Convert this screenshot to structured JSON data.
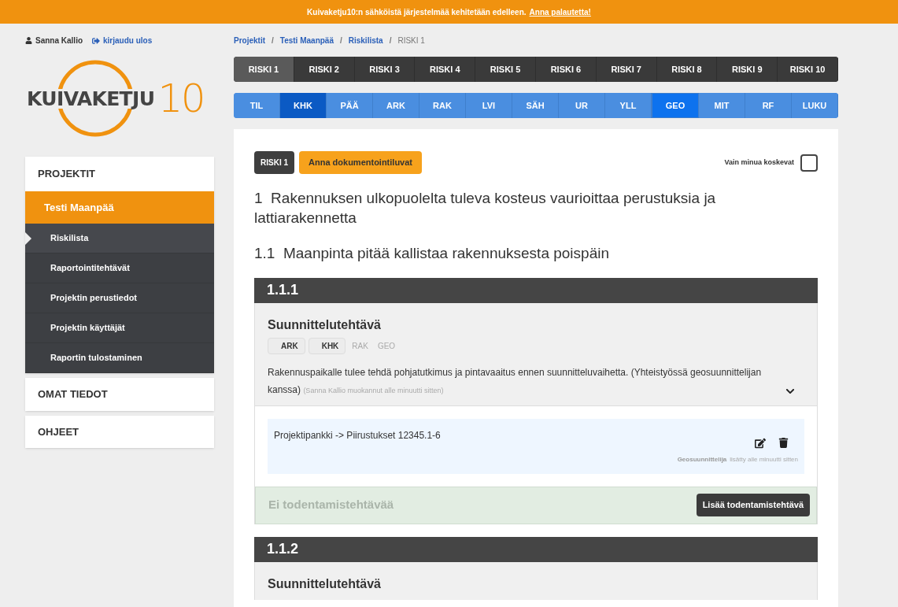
{
  "banner": {
    "text": "Kuivaketju10:n sähköistä järjestelmää kehitetään edelleen.",
    "link": "Anna palautetta!"
  },
  "user": {
    "name": "Sanna Kallio",
    "logout": "kirjaudu ulos"
  },
  "logo": {
    "text": "KUIVAKETJU",
    "number": "10"
  },
  "breadcrumb": [
    {
      "label": "Projektit",
      "link": true
    },
    {
      "separator": "/",
      "label": "Testi Maanpää",
      "link": true
    },
    {
      "separator": "/",
      "label": "Riskilista",
      "link": true
    },
    {
      "separator": "/",
      "label": "RISKI 1",
      "link": false
    }
  ],
  "risk_tabs": [
    {
      "label": "RISKI 1",
      "selected": true
    },
    {
      "label": "RISKI 2",
      "selected": false
    },
    {
      "label": "RISKI 3",
      "selected": false
    },
    {
      "label": "RISKI 4",
      "selected": false
    },
    {
      "label": "RISKI 5",
      "selected": false
    },
    {
      "label": "RISKI 6",
      "selected": false
    },
    {
      "label": "RISKI 7",
      "selected": false
    },
    {
      "label": "RISKI 8",
      "selected": false
    },
    {
      "label": "RISKI 9",
      "selected": false
    },
    {
      "label": "RISKI 10",
      "selected": false
    }
  ],
  "discipline_tabs": [
    {
      "label": "TIL",
      "selected": false,
      "own": false
    },
    {
      "label": "KHK",
      "selected": false,
      "own": true
    },
    {
      "label": "PÄÄ",
      "selected": false,
      "own": false
    },
    {
      "label": "ARK",
      "selected": false,
      "own": false
    },
    {
      "label": "RAK",
      "selected": false,
      "own": false
    },
    {
      "label": "LVI",
      "selected": false,
      "own": false
    },
    {
      "label": "SÄH",
      "selected": false,
      "own": false
    },
    {
      "label": "UR",
      "selected": false,
      "own": false
    },
    {
      "label": "YLL",
      "selected": false,
      "own": false
    },
    {
      "label": "GEO",
      "selected": true,
      "own": false
    },
    {
      "label": "MIT",
      "selected": false,
      "own": false
    },
    {
      "label": "RF",
      "selected": false,
      "own": false
    },
    {
      "label": "LUKU",
      "selected": false,
      "own": false
    }
  ],
  "sidebar": [
    {
      "label": "PROJEKTIT",
      "expanded": true,
      "children": [
        {
          "label": "Testi Maanpää",
          "selected": true,
          "children": [
            {
              "label": "Riskilista",
              "selected": true
            },
            {
              "label": "Raportointitehtävät",
              "selected": false
            },
            {
              "label": "Projektin perustiedot",
              "selected": false
            },
            {
              "label": "Projektin käyttäjät",
              "selected": false
            },
            {
              "label": "Raportin tulostaminen",
              "selected": false
            }
          ]
        }
      ]
    },
    {
      "label": "OMAT TIEDOT",
      "expanded": false
    },
    {
      "label": "OHJEET",
      "expanded": false
    }
  ],
  "content": {
    "risk_badge": "RISKI 1",
    "permissions_button": "Anna dokumentointiluvat",
    "filter": {
      "label": "Vain minua koskevat",
      "checked": false
    },
    "heading": "1  Rakennuksen ulkopuolelta tuleva kosteus vaurioittaa perustuksia ja lattiarakennetta",
    "subheading": "1.1  Maanpinta pitää kallistaa rakennuksesta poispäin",
    "sections": [
      {
        "number": "1.1.1",
        "task_title": "Suunnittelutehtävä",
        "tags": [
          {
            "label": "ARK",
            "active": true
          },
          {
            "label": "KHK",
            "active": true
          },
          {
            "label": "RAK",
            "active": false
          },
          {
            "label": "GEO",
            "active": false
          }
        ],
        "description": "Rakennuspaikalle tulee tehdä pohjatutkimus ja pintavaaitus ennen suunnitteluvaihetta. (Yhteistyössä geosuunnittelijan kanssa)",
        "edited_note": "(Sanna Kallio muokannut alle minuutti sitten)",
        "expanded": true,
        "entries": [
          {
            "text": "Projektipankki -> Piirustukset 12345.1-6",
            "author": "Geosuunnittelija",
            "time": "lisätty alle minuutti sitten"
          }
        ],
        "verification": {
          "empty_text": "Ei todentamistehtävää",
          "button": "Lisää todentamistehtävä"
        }
      },
      {
        "number": "1.1.2",
        "task_title": "Suunnittelutehtävä"
      }
    ]
  }
}
